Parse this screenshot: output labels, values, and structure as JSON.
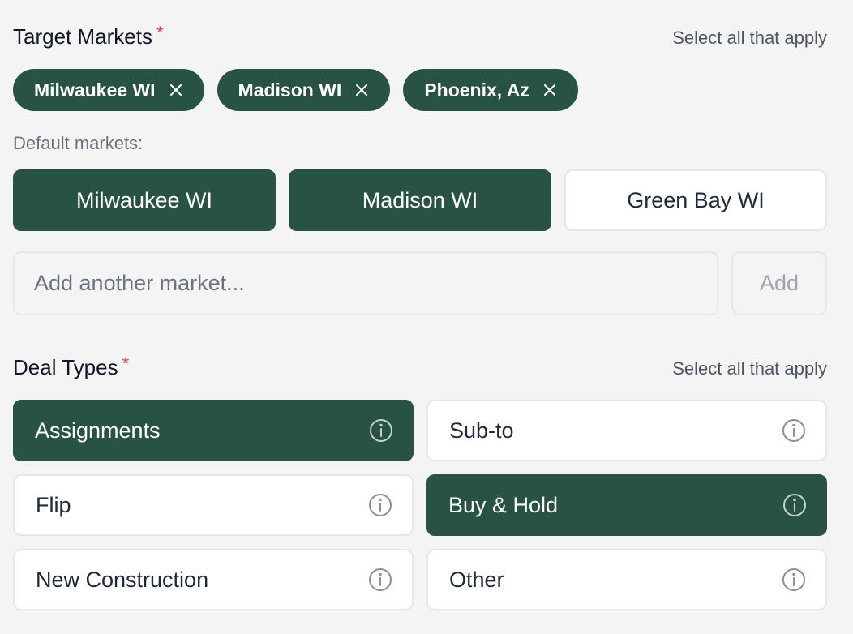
{
  "target_markets": {
    "title": "Target Markets",
    "required_mark": "*",
    "hint": "Select all that apply",
    "selected_chips": [
      {
        "label": "Milwaukee WI"
      },
      {
        "label": "Madison WI"
      },
      {
        "label": "Phoenix, Az"
      }
    ],
    "default_label": "Default markets:",
    "defaults": [
      {
        "label": "Milwaukee WI",
        "selected": true
      },
      {
        "label": "Madison WI",
        "selected": true
      },
      {
        "label": "Green Bay WI",
        "selected": false
      }
    ],
    "add_input": {
      "placeholder": "Add another market...",
      "value": ""
    },
    "add_button": "Add"
  },
  "deal_types": {
    "title": "Deal Types",
    "required_mark": "*",
    "hint": "Select all that apply",
    "options": [
      {
        "label": "Assignments",
        "selected": true
      },
      {
        "label": "Sub-to",
        "selected": false
      },
      {
        "label": "Flip",
        "selected": false
      },
      {
        "label": "Buy & Hold",
        "selected": true
      },
      {
        "label": "New Construction",
        "selected": false
      },
      {
        "label": "Other",
        "selected": false
      }
    ]
  },
  "colors": {
    "accent": "#285343",
    "required": "#e03e3e",
    "background": "#f4f4f4"
  },
  "icons": {
    "chip_remove": "close-icon",
    "option_info": "info-icon"
  }
}
